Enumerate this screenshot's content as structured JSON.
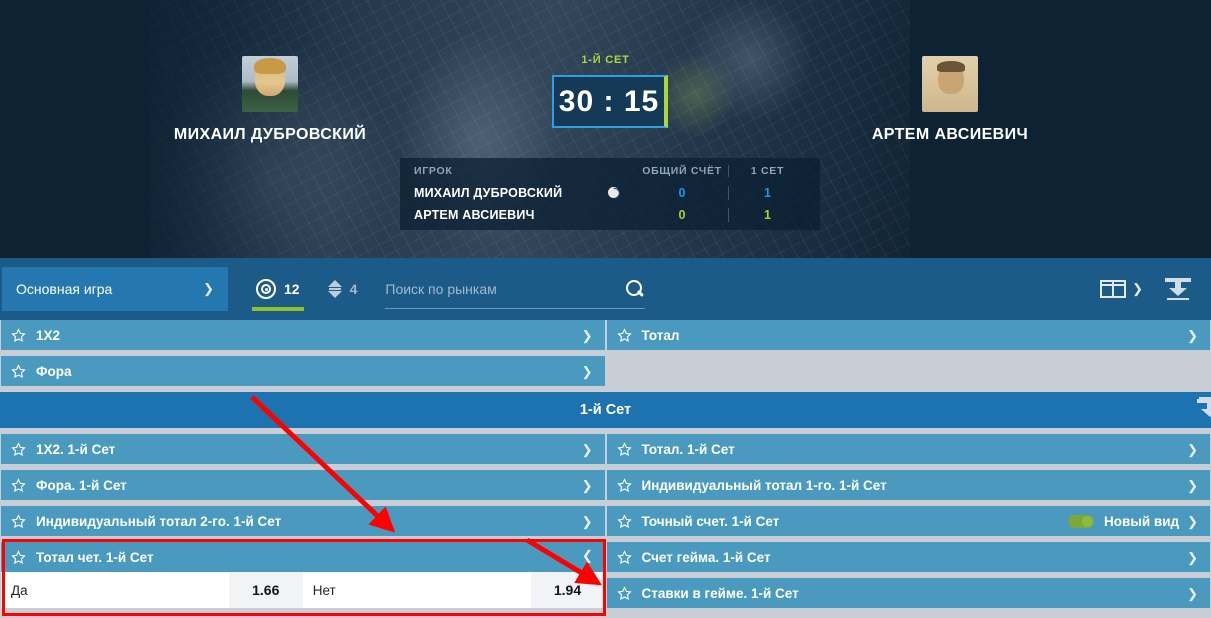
{
  "hero": {
    "set_label": "1-Й СЕТ",
    "score": "30 : 15",
    "player_left": {
      "name": "МИХАИЛ ДУБРОВСКИЙ"
    },
    "player_right": {
      "name": "АРТЕМ АВСИЕВИЧ"
    },
    "board": {
      "headers": {
        "player": "ИГРОК",
        "total": "ОБЩИЙ СЧЁТ",
        "set1": "1 СЕТ"
      },
      "rows": [
        {
          "name": "МИХАИЛ ДУБРОВСКИЙ",
          "serving": true,
          "total": "0",
          "set1": "1",
          "color": "#1e9ae8"
        },
        {
          "name": "АРТЕМ АВСИЕВИЧ",
          "serving": false,
          "total": "0",
          "set1": "1",
          "color": "#a5d432"
        }
      ]
    }
  },
  "toolbar": {
    "market_select_label": "Основная игра",
    "tabs": [
      {
        "icon": "target-icon",
        "count": "12",
        "active": true
      },
      {
        "icon": "up-down-icon",
        "count": "4",
        "active": false
      }
    ],
    "search_placeholder": "Поиск по рынкам",
    "search_value": "",
    "columns_icon": "two-columns-icon",
    "collapse_icon": "collapse-all-icon"
  },
  "main_markets": {
    "left": [
      {
        "label": "1X2",
        "expanded": false
      },
      {
        "label": "Фора",
        "expanded": false
      }
    ],
    "right": [
      {
        "label": "Тотал",
        "expanded": false
      }
    ]
  },
  "set_section": {
    "title": "1-й Сет",
    "left": [
      {
        "label": "1X2. 1-й Сет",
        "expanded": false
      },
      {
        "label": "Фора. 1-й Сет",
        "expanded": false
      },
      {
        "label": "Индивидуальный тотал 2-го. 1-й Сет",
        "expanded": false
      },
      {
        "label": "Тотал чет. 1-й Сет",
        "expanded": true,
        "outcomes": [
          {
            "name": "Да",
            "odd": "1.66"
          },
          {
            "name": "Нет",
            "odd": "1.94"
          }
        ]
      }
    ],
    "right": [
      {
        "label": "Тотал. 1-й Сет",
        "expanded": false
      },
      {
        "label": "Индивидуальный тотал 1-го. 1-й Сет",
        "expanded": false
      },
      {
        "label": "Точный счет. 1-й Сет",
        "expanded": false,
        "toggle_label": "Новый вид",
        "toggle_on": true
      },
      {
        "label": "Счет гейма. 1-й Сет",
        "expanded": false
      },
      {
        "label": "Ставки в гейме. 1-й Сет",
        "expanded": false
      }
    ]
  },
  "colors": {
    "hero_bg": "#0d2233",
    "toolbar_bg": "#1c5b87",
    "market_row": "#4a9ac0",
    "section_head": "#1d72b0",
    "accent_green": "#8fbf2b",
    "accent_blue": "#1e9ae8",
    "page_bg": "#c8ced6",
    "annotation": "#ff0000"
  }
}
